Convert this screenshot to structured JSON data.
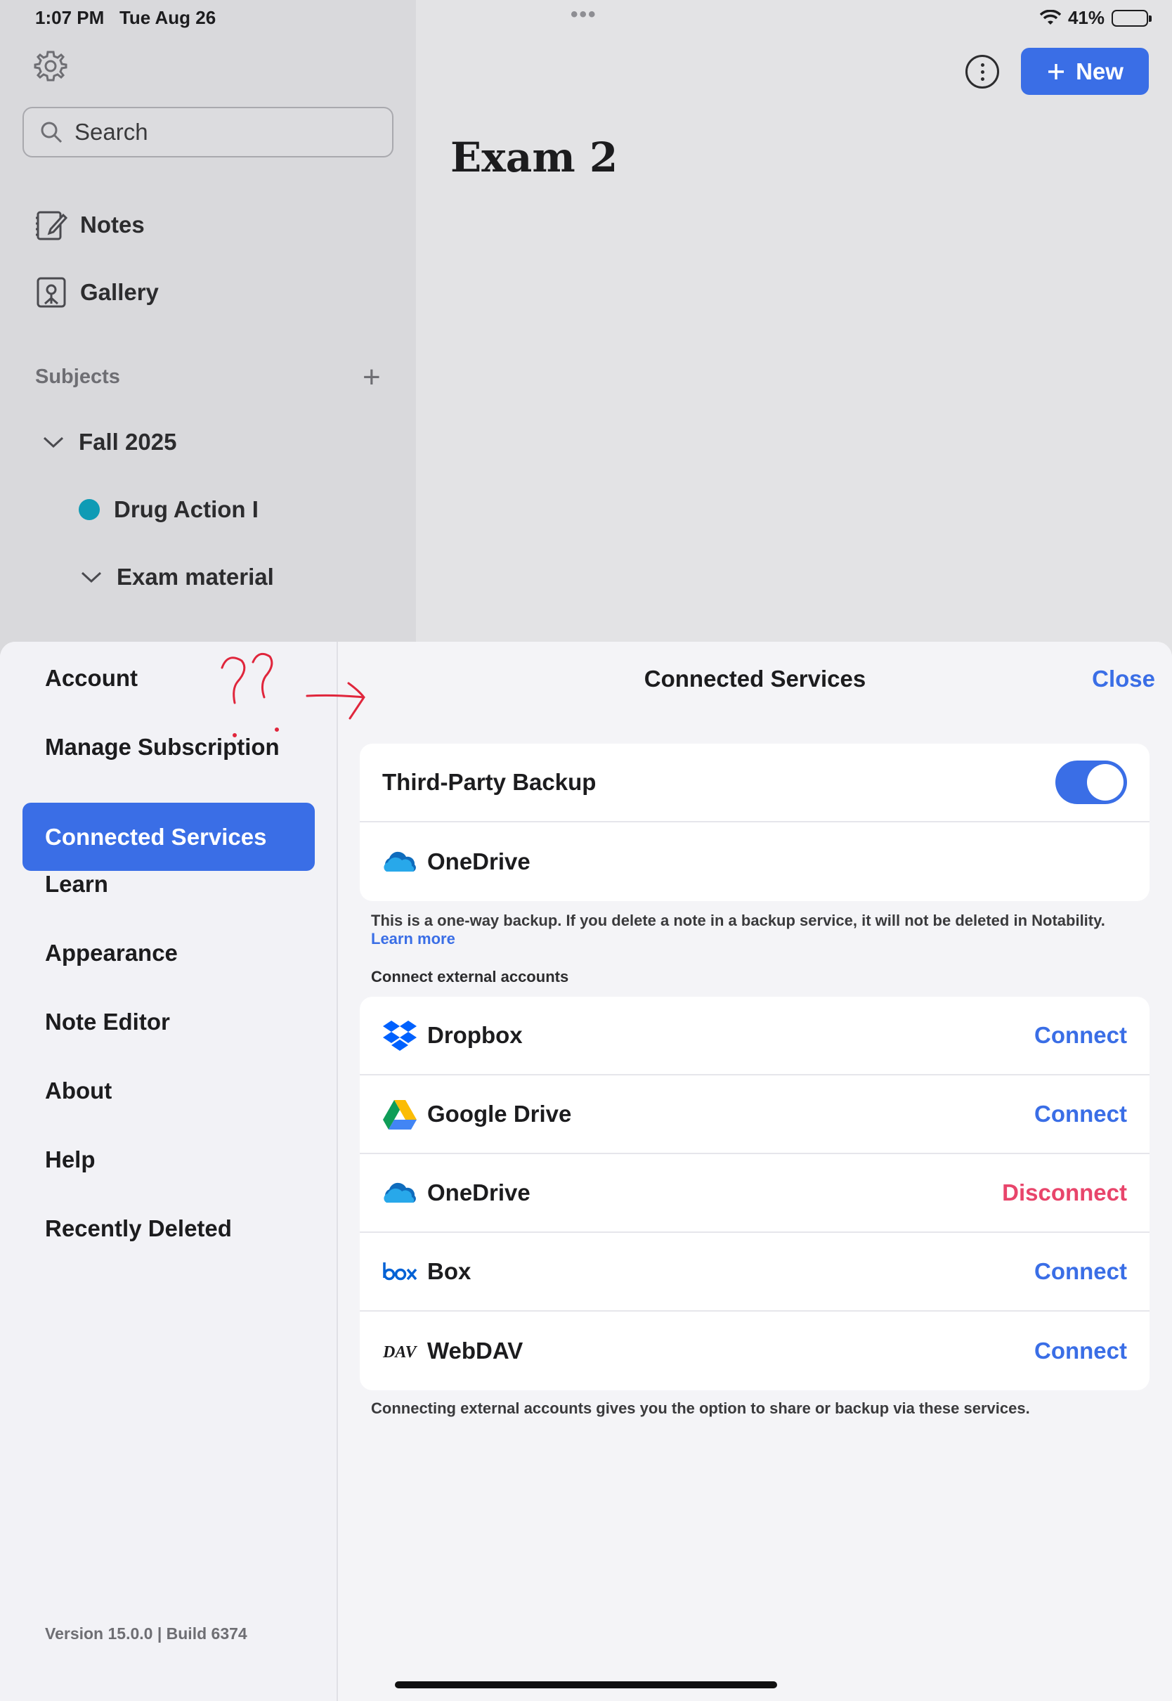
{
  "status_bar": {
    "time": "1:07 PM",
    "date": "Tue Aug 26",
    "battery": "41%",
    "battery_level": 0.41
  },
  "sidebar": {
    "search_placeholder": "Search",
    "nav": [
      {
        "label": "Notes",
        "icon": "notes-icon"
      },
      {
        "label": "Gallery",
        "icon": "gallery-icon"
      }
    ],
    "subjects_label": "Subjects",
    "tree": [
      {
        "label": "Fall 2025",
        "type": "folder-expanded"
      },
      {
        "label": "Drug Action I",
        "type": "subject"
      },
      {
        "label": "Exam material",
        "type": "folder-expanded"
      }
    ]
  },
  "main": {
    "new_label": "New",
    "note_title": "Exam 2"
  },
  "settings": {
    "nav": [
      "Account",
      "Manage Subscription",
      "Connected Services",
      "Learn",
      "Appearance",
      "Note Editor",
      "About",
      "Help",
      "Recently Deleted"
    ],
    "active": "Connected Services",
    "version": "Version 15.0.0 | Build 6374"
  },
  "connected_services": {
    "title": "Connected Services",
    "close_label": "Close",
    "backup": {
      "label": "Third-Party Backup",
      "enabled": true,
      "service": "OneDrive"
    },
    "backup_note": "This is a one-way backup. If you delete a note in a backup service, it will not be deleted in Notability.",
    "learn_more": "Learn more",
    "external_header": "Connect external accounts",
    "services": [
      {
        "name": "Dropbox",
        "action": "Connect",
        "icon": "dropbox-icon"
      },
      {
        "name": "Google Drive",
        "action": "Connect",
        "icon": "google-drive-icon"
      },
      {
        "name": "OneDrive",
        "action": "Disconnect",
        "icon": "onedrive-icon"
      },
      {
        "name": "Box",
        "action": "Connect",
        "icon": "box-icon"
      },
      {
        "name": "WebDAV",
        "action": "Connect",
        "icon": "webdav-icon"
      }
    ],
    "footer_note": "Connecting external accounts gives you the option to share or backup via these services."
  },
  "colors": {
    "accent": "#3a6ee6",
    "danger": "#e8456b",
    "subject_dot": "#0e9bb5"
  }
}
